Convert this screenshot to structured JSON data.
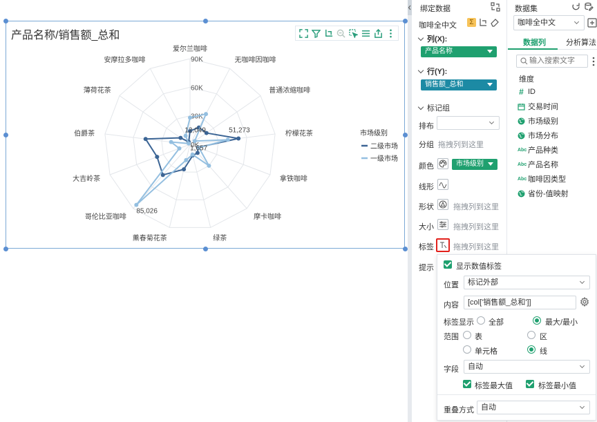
{
  "chart": {
    "title": "产品名称/销售额_总和",
    "legend_title": "市场级别"
  },
  "chart_data": {
    "type": "radar",
    "title": "产品名称/销售额_总和",
    "categories": [
      "爱尔兰咖啡",
      "无咖啡因咖啡",
      "普通浓缩咖啡",
      "柠檬花茶",
      "拿铁咖啡",
      "摩卡咖啡",
      "绿茶",
      "薰春菊花茶",
      "哥伦比亚咖啡",
      "大吉岭茶",
      "伯爵茶",
      "薄荷花茶",
      "安摩拉多咖啡"
    ],
    "axis_ticks": [
      "0K",
      "30K",
      "60K",
      "90K"
    ],
    "range": [
      0,
      90000
    ],
    "series": [
      {
        "name": "二级市场",
        "color": "#3c6595",
        "values": [
          14000,
          20000,
          21000,
          51273,
          9000,
          12000,
          12000,
          27000,
          43000,
          37000,
          47000,
          12049,
          3000
        ]
      },
      {
        "name": "一级市场",
        "color": "#94bfe0",
        "values": [
          28000,
          36000,
          6000,
          40000,
          10000,
          30000,
          11000,
          17000,
          85026,
          12000,
          20000,
          1657,
          10000
        ]
      }
    ],
    "data_labels": [
      "51,273",
      "12,049",
      "1,657",
      "85,026"
    ],
    "legend_position": "right",
    "grid": true
  },
  "binding": {
    "header": "绑定数据",
    "dataset": "咖啡全中文",
    "columns_label": "列(X):",
    "columns_pill": "产品名称",
    "rows_label": "行(Y):",
    "rows_pill": "销售额_总和",
    "marks_label": "标记组",
    "layout_label": "排布",
    "group_label": "分组",
    "group_hint": "拖拽列到这里",
    "color_label": "颜色",
    "color_pill": "市场级别",
    "line_label": "线形",
    "shape_label": "形状",
    "shape_hint": "拖拽列到这里",
    "size_label": "大小",
    "size_hint": "拖拽列到这里",
    "label_label": "标签",
    "label_hint": "拖拽列到这里",
    "tooltip_label": "提示"
  },
  "dataset_panel": {
    "header": "数据集",
    "dataset": "咖啡全中文",
    "tab_columns": "数据列",
    "tab_algorithms": "分析算法",
    "search_placeholder": "输入搜索文字",
    "dimension_label": "维度",
    "fields": [
      {
        "icon": "#",
        "name": "ID"
      },
      {
        "icon": "date",
        "name": "交易时间"
      },
      {
        "icon": "geo",
        "name": "市场级别"
      },
      {
        "icon": "geo",
        "name": "市场分布"
      },
      {
        "icon": "Abc",
        "name": "产品种类"
      },
      {
        "icon": "Abc",
        "name": "产品名称"
      },
      {
        "icon": "Abc",
        "name": "咖啡因类型"
      },
      {
        "icon": "geo",
        "name": "省份-值映射"
      }
    ]
  },
  "label_popup": {
    "show_label": "显示数值标签",
    "position_label": "位置",
    "position_value": "标记外部",
    "content_label": "内容",
    "content_value": "[col['销售额_总和']]",
    "display_label": "标签显示",
    "opt_all": "全部",
    "opt_maxmin": "最大/最小",
    "range_label": "范围",
    "opt_table": "表",
    "opt_zone": "区",
    "opt_cell": "单元格",
    "opt_line": "线",
    "field_label": "字段",
    "field_value": "自动",
    "cb_max": "标签最大值",
    "cb_min": "标签最小值",
    "overlap_label": "重叠方式",
    "overlap_value": "自动"
  }
}
